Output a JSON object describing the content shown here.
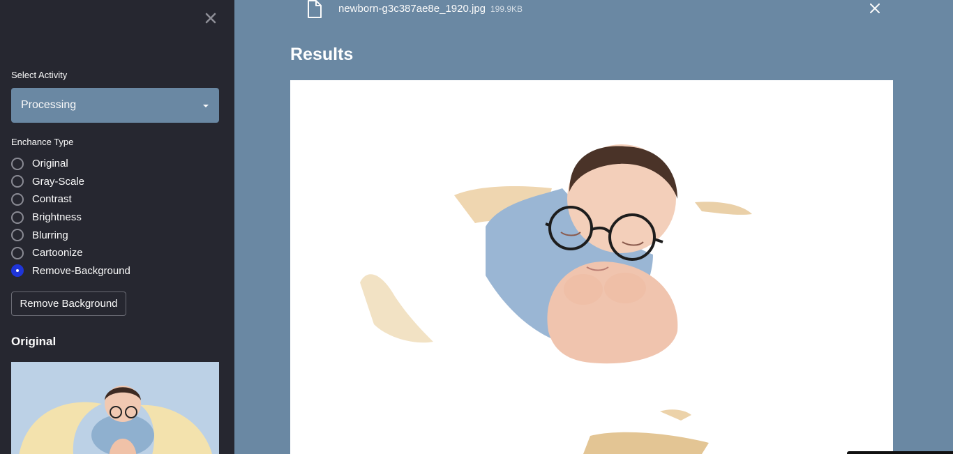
{
  "sidebar": {
    "select_label": "Select Activity",
    "select_value": "Processing",
    "enhance_label": "Enchance Type",
    "radio_options": [
      {
        "label": "Original",
        "checked": false
      },
      {
        "label": "Gray-Scale",
        "checked": false
      },
      {
        "label": "Contrast",
        "checked": false
      },
      {
        "label": "Brightness",
        "checked": false
      },
      {
        "label": "Blurring",
        "checked": false
      },
      {
        "label": "Cartoonize",
        "checked": false
      },
      {
        "label": "Remove-Background",
        "checked": true
      }
    ],
    "remove_button": "Remove Background",
    "original_heading": "Original"
  },
  "upload": {
    "file_name": "newborn-g3c387ae8e_1920.jpg",
    "file_size": "199.9KB"
  },
  "main": {
    "results_heading": "Results"
  },
  "colors": {
    "sidebar_bg": "#262730",
    "main_bg": "#6a88a3",
    "radio_checked": "#1f35d9"
  },
  "icons": {
    "close_sidebar": "close-icon",
    "file": "file-icon",
    "remove_file": "close-icon",
    "dropdown": "caret-down-icon"
  }
}
